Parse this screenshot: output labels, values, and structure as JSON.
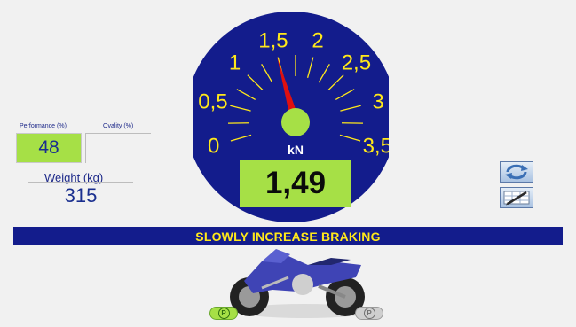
{
  "metrics": {
    "performance_label": "Performance (%)",
    "ovality_label": "Ovality (%)",
    "performance_value": "48",
    "ovality_value": "",
    "weight_label": "Weight (kg)",
    "weight_value": "315"
  },
  "gauge": {
    "unit": "kN",
    "reading": "1,49",
    "value": 1.49,
    "min": 0,
    "max": 3.5,
    "scale_labels": [
      "0",
      "0,5",
      "1",
      "1,5",
      "2",
      "2,5",
      "3",
      "3,5"
    ],
    "colors": {
      "dial": "#131c8c",
      "labels": "#ffe81a",
      "needle": "#e01010",
      "hub": "#a6e046"
    }
  },
  "tools": {
    "refresh_icon": "refresh-icon",
    "edit_icon": "edit-table-icon"
  },
  "message": {
    "text": "SLOWLY INCREASE BRAKING",
    "color": "#ffe81a",
    "background": "#131c8c"
  },
  "parking": {
    "left_label": "P",
    "right_label": "P"
  }
}
